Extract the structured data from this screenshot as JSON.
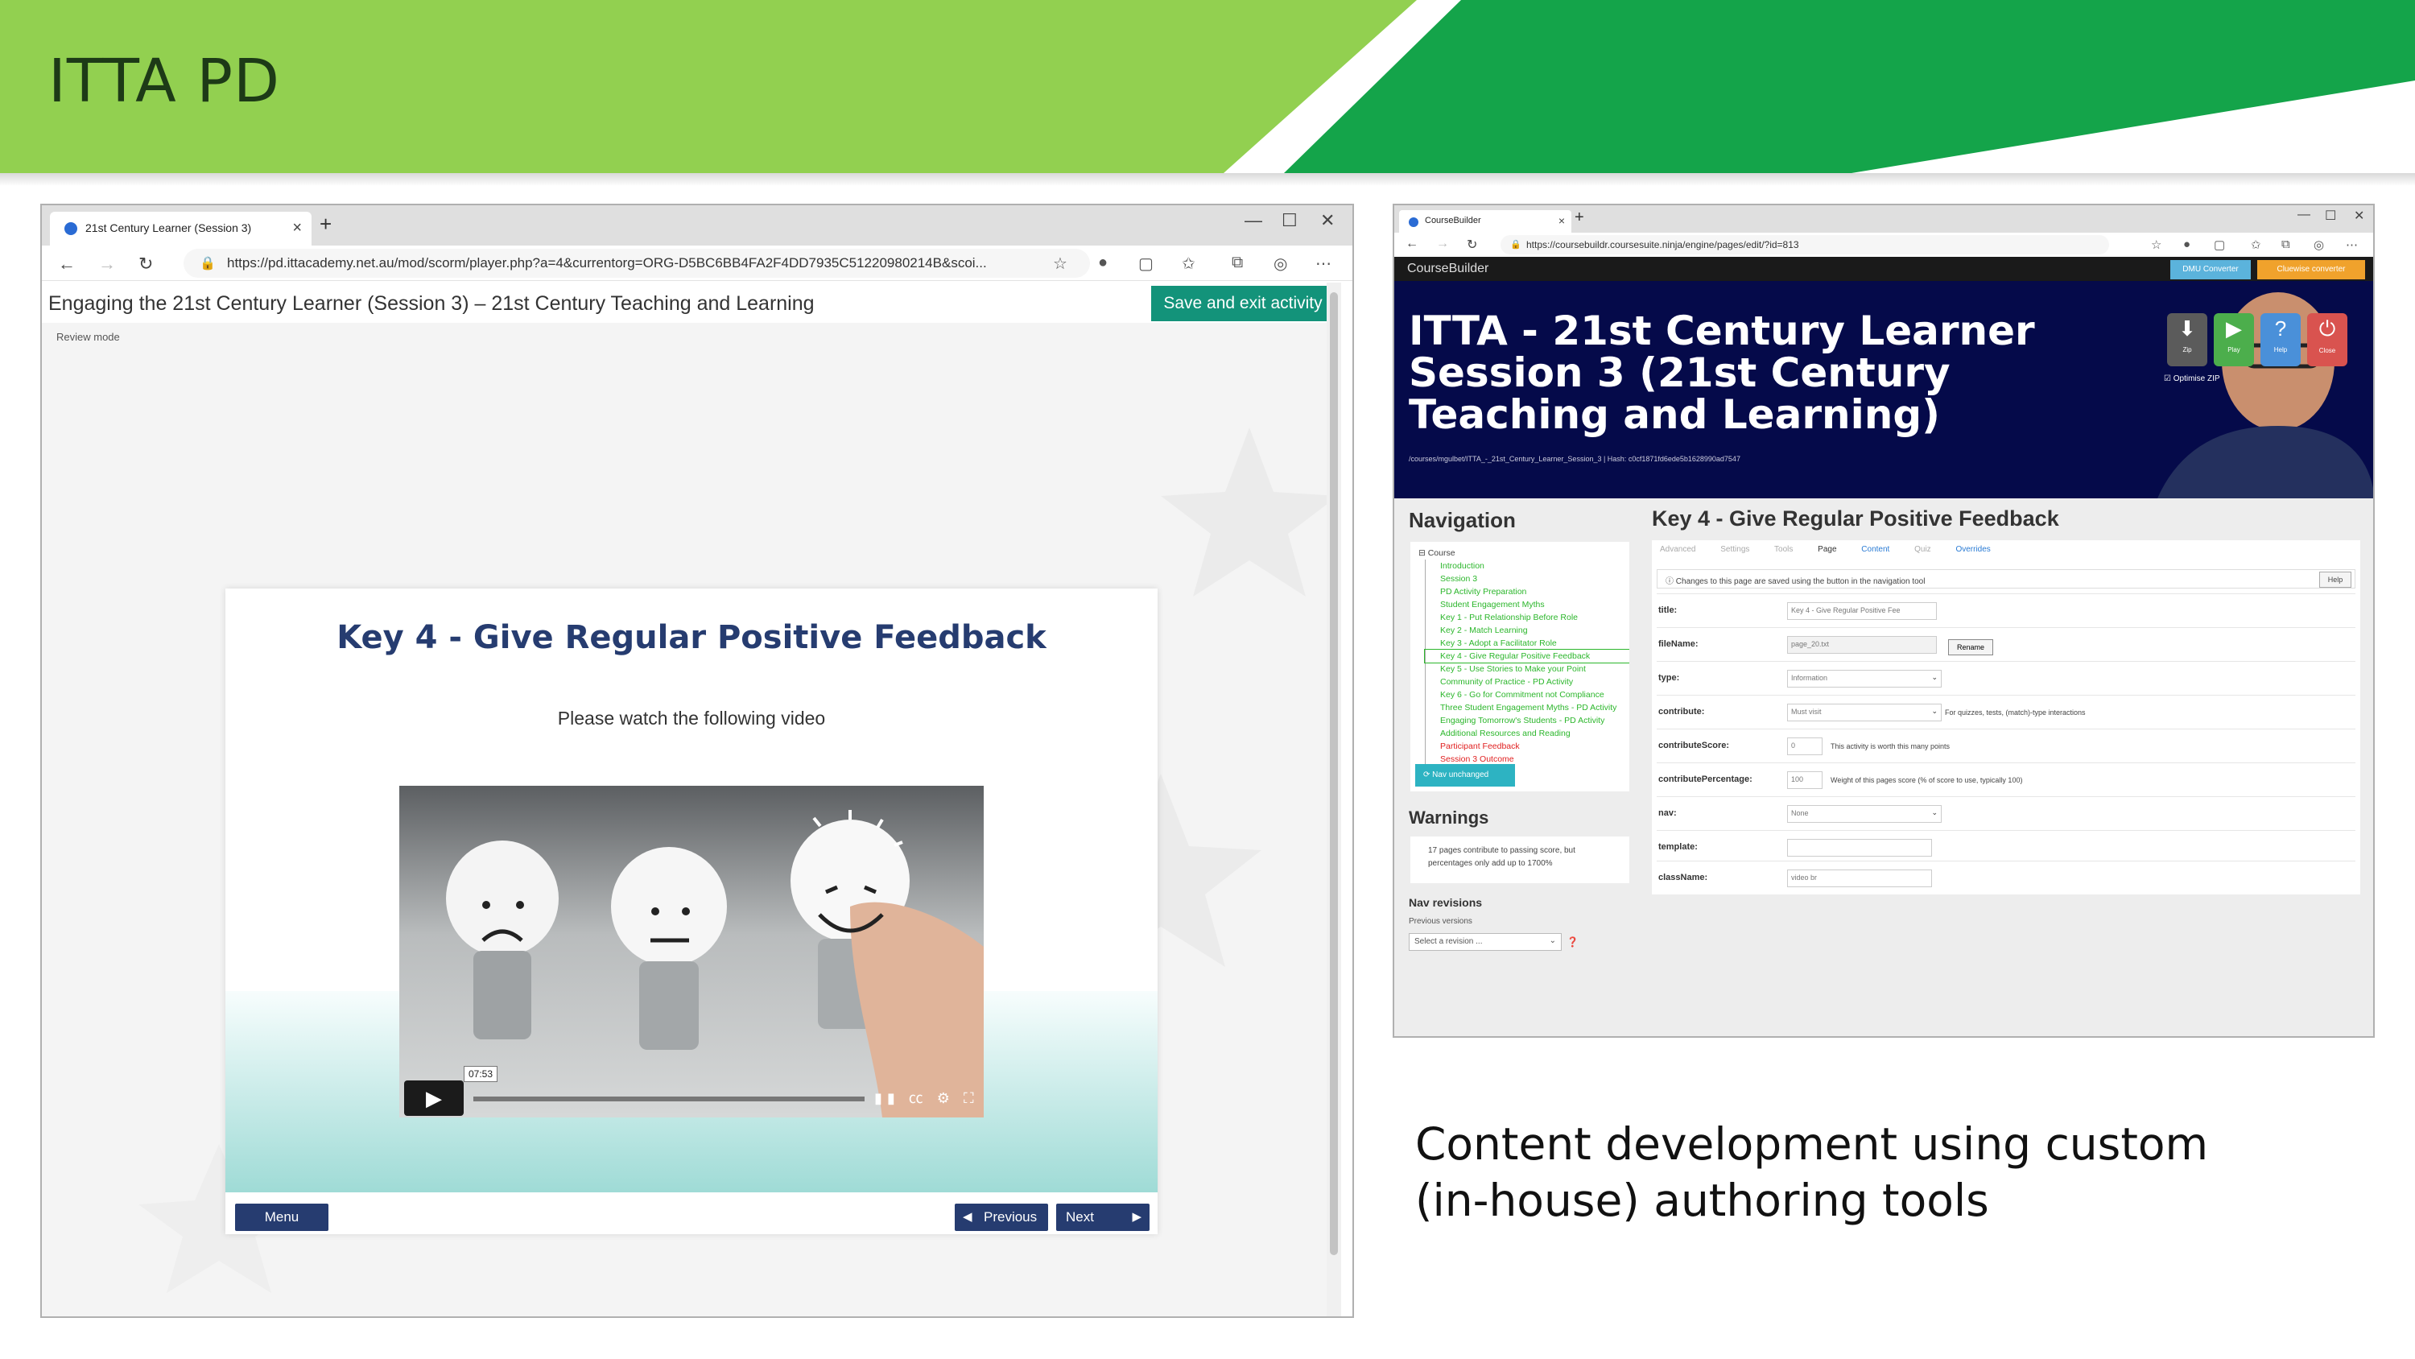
{
  "slide": {
    "title": "ITTA PD",
    "caption": "Content development using custom\n(in-house) authoring tools",
    "colors": {
      "green_light": "#92d050",
      "green_dark": "#14a44a",
      "navy": "#263c70",
      "teal": "#13937a"
    }
  },
  "left_browser": {
    "tab_title": "21st Century Learner (Session 3)",
    "url": "https://pd.ittacademy.net.au/mod/scorm/player.php?a=4&currentorg=ORG-D5BC6BB4FA2F4DD7935C51220980214B&scoi...",
    "course_title": "Engaging the 21st Century Learner (Session 3) – 21st Century Teaching and Learning",
    "save_button": "Save and exit activity",
    "review_mode": "Review mode",
    "card": {
      "heading": "Key 4 - Give Regular Positive Feedback",
      "instruction": "Please watch the following video",
      "video_time": "07:53",
      "menu_button": "Menu",
      "previous_button": "Previous",
      "next_button": "Next"
    }
  },
  "right_browser": {
    "tab_title": "CourseBuilder",
    "url": "https://coursebuildr.coursesuite.ninja/engine/pages/edit/?id=813",
    "app_name": "CourseBuilder",
    "dmu_button": "DMU Converter",
    "converter_button": "Cluewise converter",
    "hero_title": "ITTA - 21st Century Learner\nSession 3 (21st Century\nTeaching and Learning)",
    "hero_path": "/courses/mgulbet/ITTA_-_21st_Century_Learner_Session_3 | Hash: c0cf1871fd6ede5b1628990ad7547",
    "hero_buttons": [
      "Zip",
      "Play",
      "Help",
      "Close"
    ],
    "optimise_zip": "Optimise ZIP",
    "navigation": {
      "heading": "Navigation",
      "root": "Course",
      "items": [
        "Introduction",
        "Session 3",
        "PD Activity Preparation",
        "Student Engagement Myths",
        "Key 1 - Put Relationship Before Role",
        "Key 2 - Match Learning",
        "Key 3 - Adopt a Facilitator Role",
        "Key 4 - Give Regular Positive Feedback",
        "Key 5 - Use Stories to Make your Point",
        "Community of Practice - PD Activity",
        "Key 6 - Go for Commitment not Compliance",
        "Three Student Engagement Myths - PD Activity",
        "Engaging Tomorrow's Students - PD Activity",
        "Additional Resources and Reading",
        "Participant Feedback",
        "Session 3 Outcome"
      ],
      "nav_button": "Nav unchanged"
    },
    "warnings": {
      "heading": "Warnings",
      "text": "17 pages contribute to passing score, but percentages only add up to 1700%"
    },
    "nav_revisions": {
      "heading": "Nav revisions",
      "label": "Previous versions",
      "select": "Select a revision ..."
    },
    "page_editor": {
      "heading": "Key 4 - Give Regular Positive Feedback",
      "tabs": [
        "Advanced",
        "Settings",
        "Tools",
        "Page",
        "Content",
        "Quiz",
        "Overrides"
      ],
      "note": "Changes to this page are saved using the button in the navigation tool",
      "help": "Help",
      "fields": [
        {
          "label": "title:",
          "value": "Key 4 - Give Regular Positive Fee",
          "note": ""
        },
        {
          "label": "fileName:",
          "value": "page_20.txt",
          "note": "Rename"
        },
        {
          "label": "type:",
          "value": "Information",
          "note": ""
        },
        {
          "label": "contribute:",
          "value": "Must visit",
          "note": "For quizzes, tests, (match)-type interactions"
        },
        {
          "label": "contributeScore:",
          "value": "0",
          "note": "This activity is worth this many points"
        },
        {
          "label": "contributePercentage:",
          "value": "100",
          "note": "Weight of this pages score (% of score to use, typically 100)"
        },
        {
          "label": "nav:",
          "value": "None",
          "note": ""
        },
        {
          "label": "template:",
          "value": "",
          "note": ""
        },
        {
          "label": "className:",
          "value": "video br",
          "note": ""
        }
      ]
    }
  }
}
